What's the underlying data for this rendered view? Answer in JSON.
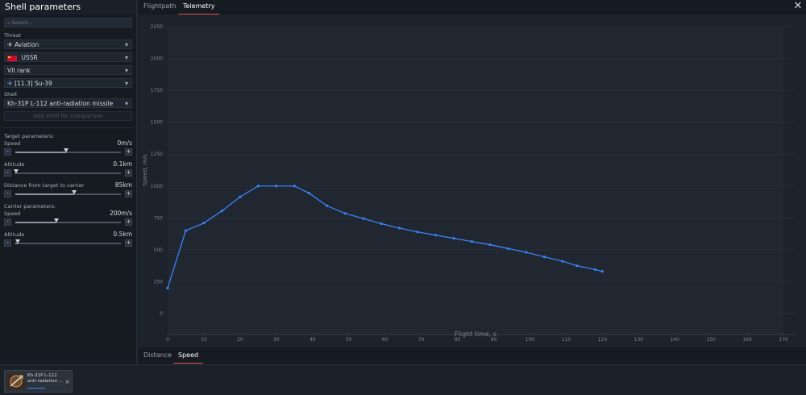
{
  "sidebar": {
    "title": "Shell parameters",
    "search_placeholder": "Search...",
    "threat_label": "Threat",
    "threat": "Aviation",
    "country": "USSR",
    "rank": "VII rank",
    "vehicle": "[11.3] Su-39",
    "shell_label": "Shell",
    "shell": "Kh-31P L-112 anti-radiation missile",
    "add_shell_label": "Add shell for comparison",
    "target_params_label": "Target parameters:",
    "target_speed_label": "Speed",
    "target_speed_value": "0m/s",
    "target_speed_level": 0.48,
    "target_altitude_label": "Altitude",
    "target_altitude_value": "0.1km",
    "target_altitude_level": 0.01,
    "distance_label": "Distance from target to carrier",
    "distance_value": "85km",
    "distance_level": 0.56,
    "carrier_params_label": "Carrier parameters:",
    "carrier_speed_label": "Speed",
    "carrier_speed_value": "200m/s",
    "carrier_speed_level": 0.39,
    "carrier_altitude_label": "Altitude",
    "carrier_altitude_value": "0.5km",
    "carrier_altitude_level": 0.02,
    "minus": "-",
    "plus": "+",
    "chevron": "▾"
  },
  "tabs_top": [
    "Flightpath",
    "Telemetry"
  ],
  "tabs_top_active": 1,
  "tabs_bottom": [
    "Distance",
    "Speed"
  ],
  "tabs_bottom_active": 1,
  "close_glyph": "✕",
  "bottom_card": {
    "name": "Kh-31P L-112 anti-radiation ...",
    "close": "×"
  },
  "colors": {
    "accent": "#3b82f6",
    "tab_underline": "#e05050"
  },
  "chart_data": {
    "type": "line",
    "xlabel": "Flight time, s",
    "ylabel": "Speed, m/s",
    "xlim": [
      0,
      170
    ],
    "ylim": [
      0,
      2250
    ],
    "xticks": [
      0,
      10,
      20,
      30,
      40,
      50,
      60,
      70,
      80,
      90,
      100,
      110,
      120,
      130,
      140,
      150,
      160,
      170
    ],
    "yticks": [
      0,
      250,
      500,
      750,
      1000,
      1250,
      1500,
      1750,
      2000,
      2250
    ],
    "grid": true,
    "series": [
      {
        "values": [
          [
            0,
            200
          ],
          [
            5,
            650
          ],
          [
            10,
            710
          ],
          [
            15,
            805
          ],
          [
            20,
            915
          ],
          [
            25,
            1000
          ],
          [
            30,
            1000
          ],
          [
            35,
            1000
          ],
          [
            39,
            945
          ],
          [
            44,
            845
          ],
          [
            49,
            785
          ],
          [
            54,
            745
          ],
          [
            59,
            705
          ],
          [
            64,
            670
          ],
          [
            69,
            640
          ],
          [
            74,
            615
          ],
          [
            79,
            590
          ],
          [
            84,
            565
          ],
          [
            89,
            540
          ],
          [
            94,
            510
          ],
          [
            99,
            480
          ],
          [
            104,
            445
          ],
          [
            109,
            410
          ],
          [
            113,
            375
          ],
          [
            118,
            345
          ],
          [
            120,
            330
          ]
        ],
        "markers": true
      }
    ]
  }
}
